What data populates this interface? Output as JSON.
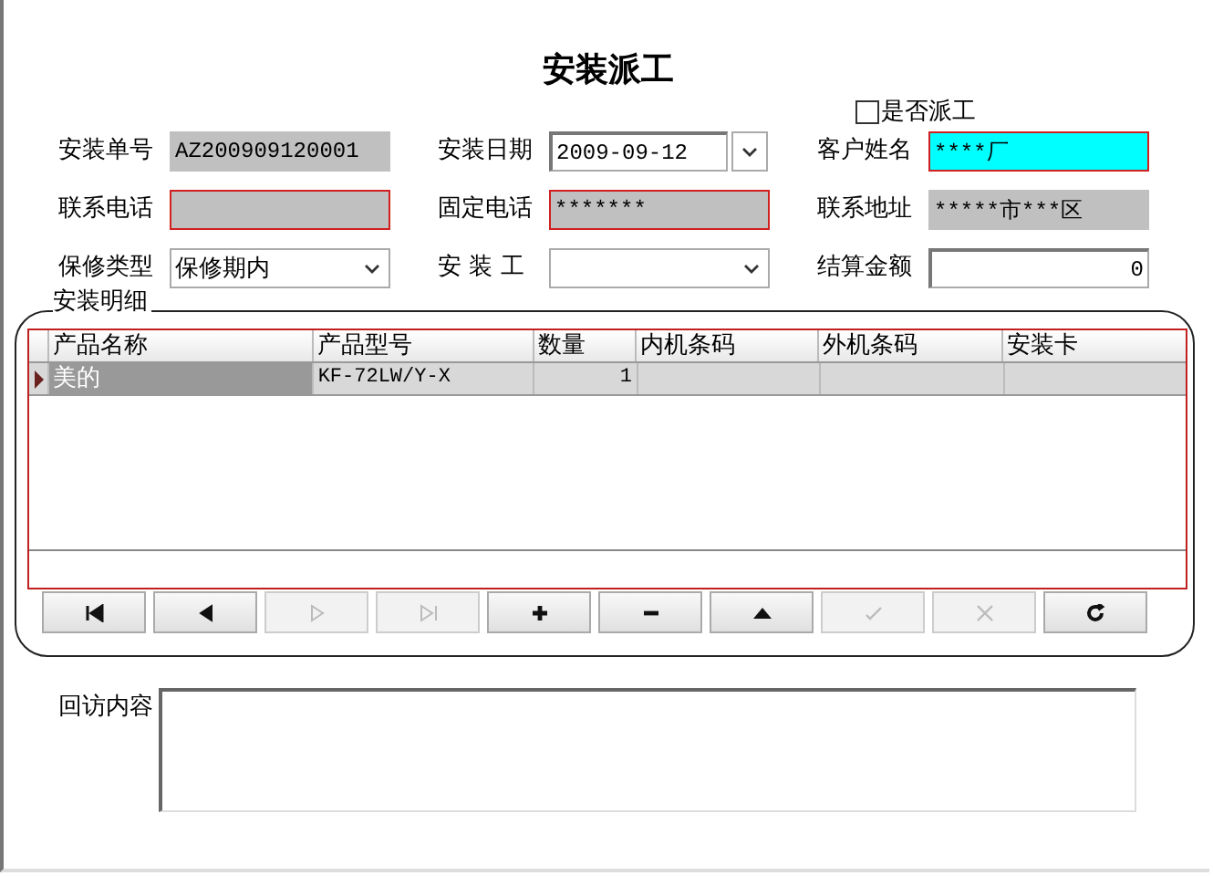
{
  "title": "安装派工",
  "dispatch_checkbox": {
    "label": "是否派工",
    "checked": false
  },
  "fields": [
    {
      "label": "安装单号",
      "value": "AZ200909120001",
      "kind": "text",
      "readonly": true,
      "required": false,
      "focused": false
    },
    {
      "label": "安装日期",
      "value": "2009-09-12",
      "kind": "date",
      "readonly": false,
      "required": false,
      "focused": false
    },
    {
      "label": "客户姓名",
      "value": "****厂",
      "kind": "text",
      "readonly": false,
      "required": true,
      "focused": true
    },
    {
      "label": "联系电话",
      "kind": "text",
      "readonly": true,
      "required": true,
      "focused": false
    },
    {
      "label": "固定电话",
      "value": "*******",
      "kind": "text",
      "readonly": true,
      "required": true,
      "focused": false
    },
    {
      "label": "联系地址",
      "value": "*****市***区",
      "kind": "text",
      "readonly": true,
      "required": false,
      "focused": false
    },
    {
      "label": "保修类型",
      "value": "保修期内",
      "kind": "select",
      "readonly": false,
      "required": false,
      "focused": false
    },
    {
      "label": "安 装 工",
      "kind": "select",
      "readonly": false,
      "required": false,
      "focused": false
    },
    {
      "label": "结算金额",
      "value": "0",
      "kind": "number",
      "readonly": false,
      "required": false,
      "focused": false
    }
  ],
  "details": {
    "title": "安装明细",
    "columns": [
      "产品名称",
      "产品型号",
      "数量",
      "内机条码",
      "外机条码",
      "安装卡"
    ],
    "rows": [
      {
        "selected": true,
        "cells": [
          "美的",
          "KF-72LW/Y-X",
          "1",
          "",
          "",
          ""
        ]
      }
    ]
  },
  "navigator": [
    {
      "kind": "first",
      "enabled": true
    },
    {
      "kind": "prior",
      "enabled": true
    },
    {
      "kind": "next",
      "enabled": false
    },
    {
      "kind": "last",
      "enabled": false
    },
    {
      "kind": "insert",
      "enabled": true
    },
    {
      "kind": "delete",
      "enabled": true
    },
    {
      "kind": "edit",
      "enabled": true
    },
    {
      "kind": "post",
      "enabled": false
    },
    {
      "kind": "cancel",
      "enabled": false
    },
    {
      "kind": "refresh",
      "enabled": true
    }
  ],
  "followup": {
    "label": "回访内容"
  }
}
